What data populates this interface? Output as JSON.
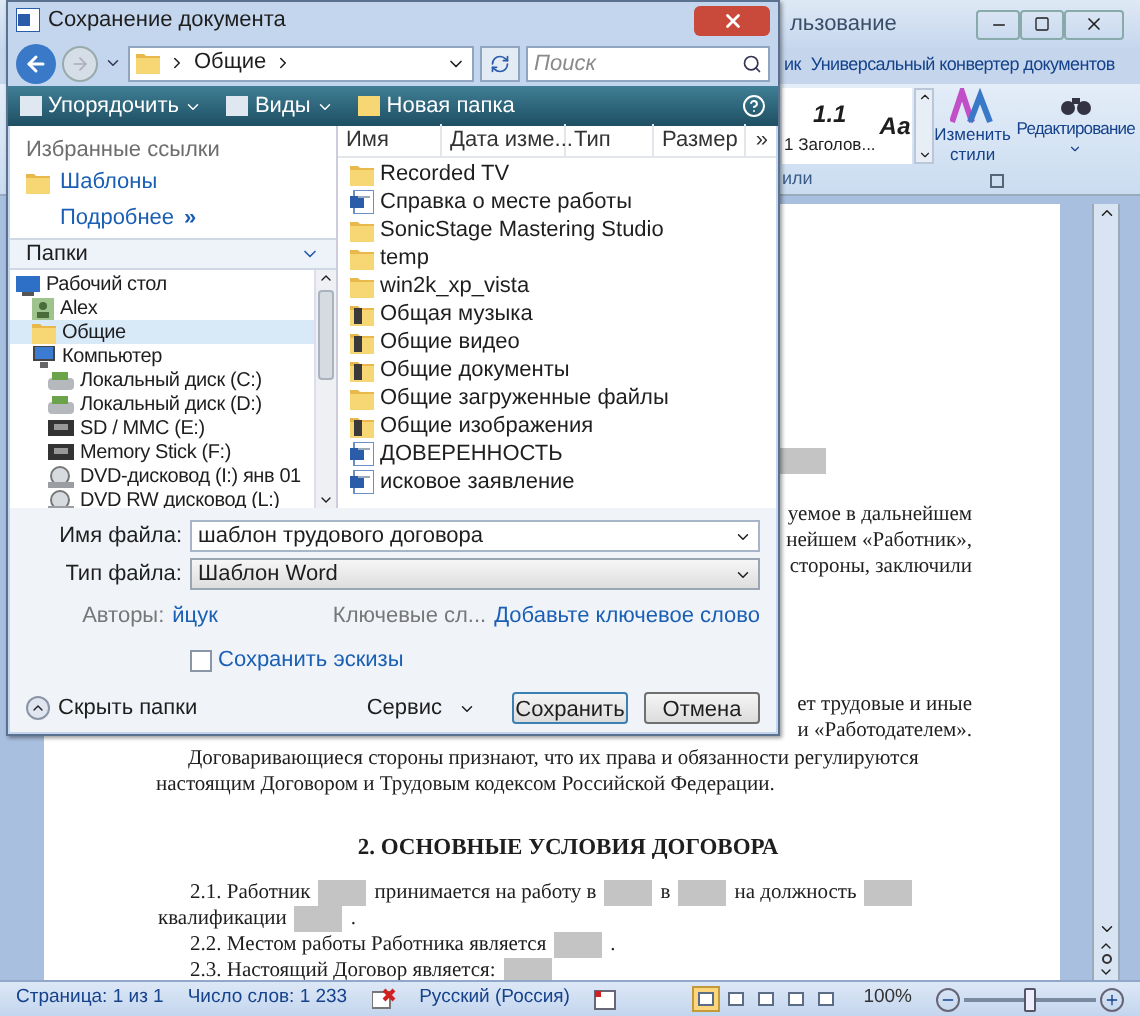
{
  "word": {
    "title": "льзование",
    "tabs": [
      "ик",
      "Универсальный конвертер документов"
    ],
    "styles": [
      {
        "sample": "1.1",
        "label": "1 Заголов..."
      },
      {
        "sample": "Аа"
      }
    ],
    "styles_group": "или",
    "change_styles": "Изменить стили",
    "editing": "Редактирование",
    "document": {
      "fragments": [
        "уемое в дальнейшем",
        "нейшем «Работник»,",
        "стороны, заключили"
      ],
      "fragments2": [
        "ет трудовые и иные",
        "и «Работодателем»."
      ],
      "lines": [
        "Договаривающиеся стороны признают, что их права и обязанности регулируются",
        "настоящим Договором и Трудовым кодексом Российской Федерации."
      ],
      "heading": "2. ОСНОВНЫЕ УСЛОВИЯ ДОГОВОРА",
      "clauses": [
        {
          "indent": true,
          "parts": [
            {
              "kind": "text",
              "text": "2.1. Работник"
            },
            {
              "kind": "blank"
            },
            {
              "kind": "text",
              "text": "принимается на работу в"
            },
            {
              "kind": "blank"
            },
            {
              "kind": "text",
              "text": "в"
            },
            {
              "kind": "blank"
            },
            {
              "kind": "text",
              "text": "на должность"
            },
            {
              "kind": "blank"
            }
          ]
        },
        {
          "indent": false,
          "parts": [
            {
              "kind": "text",
              "text": "квалификации"
            },
            {
              "kind": "blank"
            },
            {
              "kind": "text",
              "text": "."
            }
          ]
        },
        {
          "indent": true,
          "parts": [
            {
              "kind": "text",
              "text": "2.2. Местом  работы Работника является"
            },
            {
              "kind": "blank"
            },
            {
              "kind": "text",
              "text": "."
            }
          ]
        },
        {
          "indent": true,
          "parts": [
            {
              "kind": "text",
              "text": "2.3. Настоящий Договор является:"
            },
            {
              "kind": "blank"
            }
          ]
        }
      ]
    },
    "status": {
      "page": "Страница: 1 из 1",
      "words": "Число слов: 1 233",
      "language": "Русский (Россия)",
      "views": [
        {
          "selected": true
        },
        {
          "selected": false
        },
        {
          "selected": false
        },
        {
          "selected": false
        },
        {
          "selected": false
        }
      ],
      "zoom": "100%",
      "zoom_slider": {
        "level": 0.5
      }
    }
  },
  "dialog": {
    "title": "Сохранение документа",
    "path": "Общие",
    "search_placeholder": "Поиск",
    "toolbar": [
      {
        "label": "Упорядочить",
        "kind": "menu"
      },
      {
        "label": "Виды",
        "kind": "menu"
      },
      {
        "label": "Новая папка",
        "kind": "button"
      }
    ],
    "favorites": {
      "heading": "Избранные ссылки",
      "items": [
        "Шаблоны"
      ],
      "more": "Подробнее",
      "more_glyph": "»"
    },
    "folders_heading": "Папки",
    "tree": [
      {
        "label": "Рабочий стол",
        "kind": "desktop",
        "selected": false,
        "children": [
          {
            "label": "Alex",
            "kind": "user",
            "selected": false
          },
          {
            "label": "Общие",
            "kind": "folder",
            "selected": true
          },
          {
            "label": "Компьютер",
            "kind": "computer",
            "selected": false,
            "children": [
              {
                "label": "Локальный диск (C:)",
                "kind": "disk",
                "selected": false
              },
              {
                "label": "Локальный диск (D:)",
                "kind": "disk",
                "selected": false
              },
              {
                "label": "SD / MMC (E:)",
                "kind": "card",
                "selected": false
              },
              {
                "label": "Memory Stick (F:)",
                "kind": "card",
                "selected": false
              },
              {
                "label": "DVD-дисковод (I:) янв 01",
                "kind": "dvd",
                "selected": false
              },
              {
                "label": "DVD RW дисковод (L:)",
                "kind": "dvd",
                "selected": false
              }
            ]
          }
        ]
      }
    ],
    "columns": [
      "Имя",
      "Дата изме...",
      "Тип",
      "Размер"
    ],
    "columns_more": "»",
    "files": [
      {
        "name": "Recorded TV",
        "kind": "folder"
      },
      {
        "name": "Справка о месте работы",
        "kind": "document"
      },
      {
        "name": "SonicStage Mastering Studio",
        "kind": "folder"
      },
      {
        "name": "temp",
        "kind": "folder"
      },
      {
        "name": "win2k_xp_vista",
        "kind": "folder"
      },
      {
        "name": "Общая музыка",
        "kind": "special"
      },
      {
        "name": "Общие видео",
        "kind": "special"
      },
      {
        "name": "Общие документы",
        "kind": "special"
      },
      {
        "name": "Общие загруженные файлы",
        "kind": "folder"
      },
      {
        "name": "Общие изображения",
        "kind": "special"
      },
      {
        "name": "ДОВЕРЕННОСТЬ",
        "kind": "document"
      },
      {
        "name": "исковое заявление",
        "kind": "document"
      }
    ],
    "file_name": {
      "label": "Имя файла:",
      "value": "шаблон трудового договора"
    },
    "file_type": {
      "label": "Тип файла:",
      "value": "Шаблон Word"
    },
    "authors": {
      "label": "Авторы:",
      "value": "йцук"
    },
    "keywords": {
      "label": "Ключевые сл...",
      "value": "Добавьте ключевое слово"
    },
    "thumbnails": {
      "label": "Сохранить эскизы",
      "checked": false
    },
    "hide_folders": "Скрыть папки",
    "tools": "Сервис",
    "buttons": [
      "Сохранить",
      "Отмена"
    ]
  }
}
